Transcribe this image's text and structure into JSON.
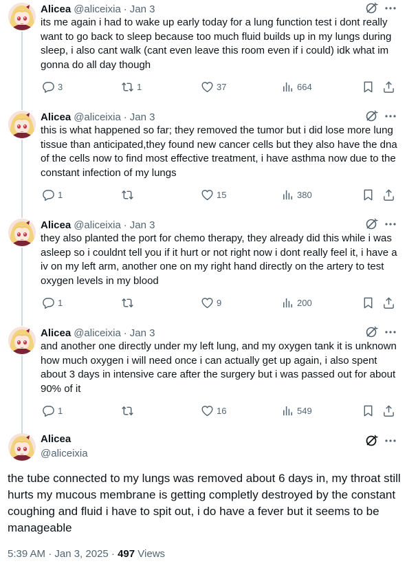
{
  "tweets": [
    {
      "name": "Alicea",
      "handle": "@aliceixia",
      "date": "Jan 3",
      "text": "its me again i had to wake up early today for a lung function test i dont really want to go back to sleep because too much fluid builds up in my lungs during sleep, i also cant walk (cant even leave this room even if i could) idk what im gonna do all day though",
      "replies": "3",
      "reposts": "1",
      "likes": "37",
      "views": "664"
    },
    {
      "name": "Alicea",
      "handle": "@aliceixia",
      "date": "Jan 3",
      "text": "this is what happened so far; they removed the tumor but i did lose more lung tissue than anticipated,they found new cancer cells but they also have the dna of the cells now to find most effective treatment, i have asthma now due to the constant infection of my lungs",
      "replies": "1",
      "reposts": "",
      "likes": "15",
      "views": "380"
    },
    {
      "name": "Alicea",
      "handle": "@aliceixia",
      "date": "Jan 3",
      "text": "they also planted the port for chemo therapy, they already did this while i was asleep so i couldnt tell you if it hurt or not right now i dont really feel it, i have a iv on my left arm, another one on my right hand directly on the artery to test oxygen levels in my blood",
      "replies": "1",
      "reposts": "",
      "likes": "9",
      "views": "200"
    },
    {
      "name": "Alicea",
      "handle": "@aliceixia",
      "date": "Jan 3",
      "text": "and another one directly under my left lung, and my oxygen tank it is unknown how much oxygen i will need once i can actually get up again, i also spent about 3 days in intensive care after the surgery but i was passed out for about 90% of it",
      "replies": "1",
      "reposts": "",
      "likes": "16",
      "views": "549"
    }
  ],
  "main": {
    "name": "Alicea",
    "handle": "@aliceixia",
    "text": "the tube connected to my lungs was removed about 6 days in, my throat still hurts my mucous membrane is getting completly destroyed by the constant coughing and fluid i have to spit out, i do have a fever but it seems to be manageable",
    "time": "5:39 AM · Jan 3, 2025 · ",
    "views_count": "497",
    "views_label": " Views"
  },
  "separator": "·",
  "icons": [
    "grok-icon",
    "more-icon",
    "reply-icon",
    "repost-icon",
    "like-icon",
    "views-icon",
    "bookmark-icon",
    "share-icon"
  ],
  "colors": {
    "text": "#0f1419",
    "secondary": "#536471",
    "thread_line": "#cfd9de",
    "background": "#ffffff"
  }
}
